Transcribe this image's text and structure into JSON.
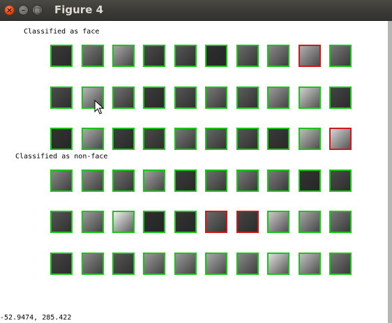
{
  "window": {
    "title": "Figure 4",
    "close_glyph": "×",
    "min_glyph": "–",
    "max_glyph": "□"
  },
  "sections": {
    "face_label": "Classified as face",
    "nonface_label": "Classified as non-face"
  },
  "rows": [
    [
      "#3a3a3a",
      "#7a7a7a",
      "#a5a5a5",
      "#4a4a4a",
      "#555",
      "#2e2e2e",
      "#6a6a6a",
      "#888",
      "#b0b0b0",
      "#777"
    ],
    [
      "#4c4c4c",
      "#b5b5b5",
      "#6e6e6e",
      "#3b3b3b",
      "#555",
      "#777",
      "#5c5c5c",
      "#9a9a9a",
      "#cfcfcf",
      "#444"
    ],
    [
      "#333",
      "#aaaaaa",
      "#3e3e3e",
      "#4a4a4a",
      "#777",
      "#666",
      "#555",
      "#3a3a3a",
      "#bdbdbd",
      "#d6d6d6"
    ],
    [
      "#888",
      "#8a8a8a",
      "#6e6e6e",
      "#a0a0a0",
      "#3a3a3a",
      "#6e6e6e",
      "#777",
      "#7a7a7a",
      "#333",
      "#4a4a4a"
    ],
    [
      "#555",
      "#9a9a9a",
      "#f2f2f2",
      "#2e2e2e",
      "#333",
      "#6a6a6a",
      "#444",
      "#c9c9c9",
      "#a5a5a5",
      "#777"
    ],
    [
      "#444",
      "#8a8a8a",
      "#555",
      "#9a9a9a",
      "#999",
      "#aaa",
      "#888",
      "#dedede",
      "#c0c0c0",
      "#777"
    ]
  ],
  "red_boxes": [
    [
      0,
      8
    ],
    [
      2,
      9
    ],
    [
      4,
      5
    ],
    [
      4,
      6
    ]
  ],
  "status_text": "-52.9474,  285.422"
}
